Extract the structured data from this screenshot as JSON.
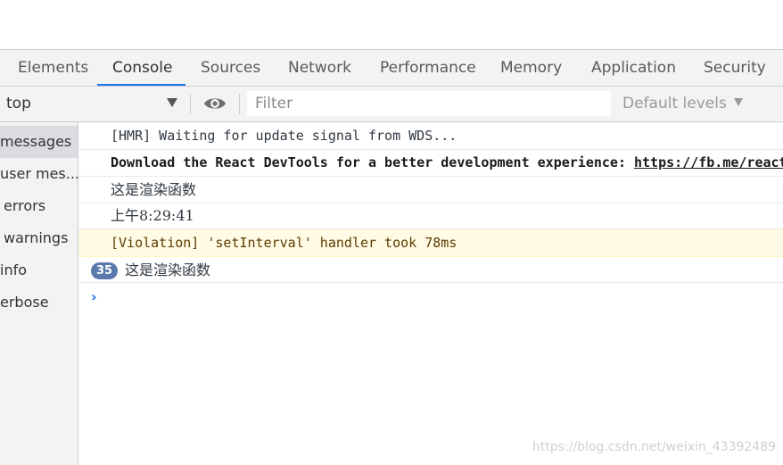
{
  "tabs": [
    {
      "label": "Elements",
      "active": false
    },
    {
      "label": "Console",
      "active": true
    },
    {
      "label": "Sources",
      "active": false
    },
    {
      "label": "Network",
      "active": false
    },
    {
      "label": "Performance",
      "active": false
    },
    {
      "label": "Memory",
      "active": false
    },
    {
      "label": "Application",
      "active": false
    },
    {
      "label": "Security",
      "active": false
    }
  ],
  "toolbar": {
    "context": "top",
    "filter_placeholder": "Filter",
    "filter_value": "",
    "levels": "Default levels",
    "icons": [
      "dropdown-arrow-icon",
      "eye-icon",
      "chevron-down-icon"
    ]
  },
  "sidebar": {
    "items": [
      {
        "label": "messages",
        "selected": true
      },
      {
        "label": "user mes...",
        "selected": false
      },
      {
        "label": "errors",
        "selected": false
      },
      {
        "label": "warnings",
        "selected": false
      },
      {
        "label": "info",
        "selected": false
      },
      {
        "label": "erbose",
        "selected": false
      }
    ]
  },
  "console": {
    "messages": [
      {
        "text": "[HMR] Waiting for update signal from WDS...",
        "level": "log"
      },
      {
        "text": "Download the React DevTools for a better development experience: ",
        "link": "https://fb.me/react-devtools",
        "level": "info"
      },
      {
        "text": "这是渲染函数",
        "level": "log"
      },
      {
        "text": "上午8:29:41",
        "level": "log"
      },
      {
        "text": "[Violation] 'setInterval' handler took 78ms",
        "level": "violation"
      },
      {
        "text": "这是渲染函数",
        "count": "35",
        "level": "log"
      }
    ],
    "prompt_icon": "chevron-right-icon"
  },
  "colors": {
    "accent": "#1a73e8",
    "warning_bg": "#fffbe5",
    "warning_text": "#5c3b00",
    "badge": "#5a79ad",
    "panel_bg": "#f3f3f3"
  },
  "watermark": "https://blog.csdn.net/weixin_43392489"
}
